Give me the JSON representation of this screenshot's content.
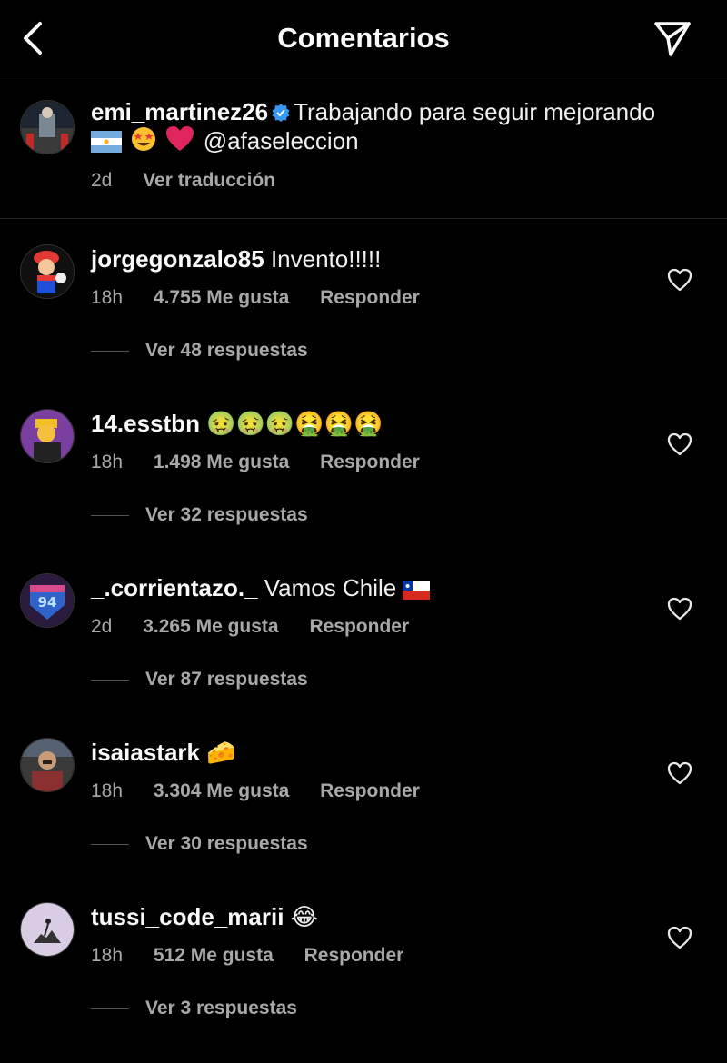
{
  "header": {
    "title": "Comentarios"
  },
  "caption": {
    "username": "emi_martinez26",
    "text": "Trabajando para seguir mejorando",
    "mention": "@afaseleccion",
    "time": "2d",
    "translate_label": "Ver traducción"
  },
  "comments": [
    {
      "username": "jorgegonzalo85",
      "text": "Invento!!!!!",
      "time": "18h",
      "likes": "4.755 Me gusta",
      "reply_label": "Responder",
      "replies": "Ver 48 respuestas"
    },
    {
      "username": "14.esstbn",
      "text": "🤢🤢🤢🤮🤮🤮",
      "time": "18h",
      "likes": "1.498 Me gusta",
      "reply_label": "Responder",
      "replies": "Ver 32 respuestas"
    },
    {
      "username": "_.corrientazo._",
      "text": "Vamos Chile",
      "time": "2d",
      "likes": "3.265 Me gusta",
      "reply_label": "Responder",
      "replies": "Ver 87 respuestas"
    },
    {
      "username": "isaiastark",
      "text": "🧀",
      "time": "18h",
      "likes": "3.304 Me gusta",
      "reply_label": "Responder",
      "replies": "Ver 30 respuestas"
    },
    {
      "username": "tussi_code_marii",
      "text": "😂",
      "time": "18h",
      "likes": "512 Me gusta",
      "reply_label": "Responder",
      "replies": "Ver 3 respuestas"
    }
  ],
  "colors": {
    "background": "#000000",
    "text": "#f5f5f5",
    "muted": "#a8a8a8",
    "verified": "#3897f0"
  }
}
